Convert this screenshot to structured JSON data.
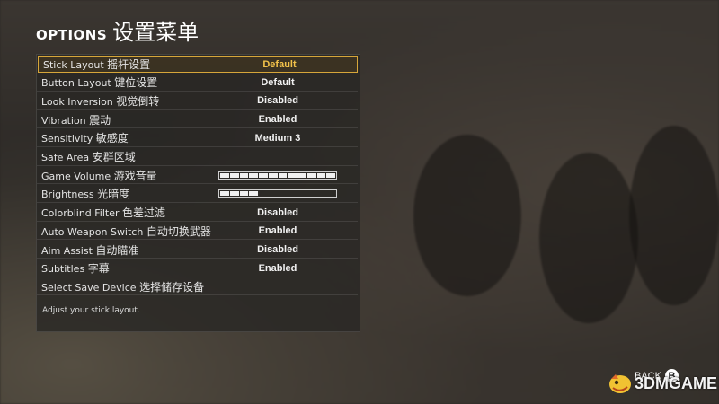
{
  "header": {
    "title_en": "OPTIONS",
    "title_cn": "设置菜单"
  },
  "options": [
    {
      "label_en": "Stick Layout",
      "label_cn": "摇杆设置",
      "value": "Default",
      "selected": true
    },
    {
      "label_en": "Button Layout",
      "label_cn": "键位设置",
      "value": "Default"
    },
    {
      "label_en": "Look Inversion",
      "label_cn": "视觉倒转",
      "value": "Disabled"
    },
    {
      "label_en": "Vibration",
      "label_cn": "震动",
      "value": "Enabled"
    },
    {
      "label_en": "Sensitivity",
      "label_cn": "敏感度",
      "value": "Medium 3"
    },
    {
      "label_en": "Safe Area",
      "label_cn": "安群区域",
      "value": ""
    },
    {
      "label_en": "Game Volume",
      "label_cn": "游戏音量",
      "level": 1.0,
      "segments": 12
    },
    {
      "label_en": "Brightness",
      "label_cn": "光暗度",
      "level": 0.33,
      "segments": 12
    },
    {
      "label_en": "Colorblind Filter",
      "label_cn": "色差过滤",
      "value": "Disabled"
    },
    {
      "label_en": "Auto Weapon Switch",
      "label_cn": "自动切换武器",
      "value": "Enabled"
    },
    {
      "label_en": "Aim Assist",
      "label_cn": "自动瞄准",
      "value": "Disabled"
    },
    {
      "label_en": "Subtitles",
      "label_cn": "字幕",
      "value": "Enabled"
    },
    {
      "label_en": "Select Save Device",
      "label_cn": "选择储存设备",
      "value": ""
    }
  ],
  "description": "Adjust your stick layout.",
  "footer": {
    "back_label": "BACK",
    "back_button": "B",
    "watermark": "3DMGAME"
  },
  "colors": {
    "highlight": "#d6a63a",
    "selected_value": "#f2c24a"
  }
}
